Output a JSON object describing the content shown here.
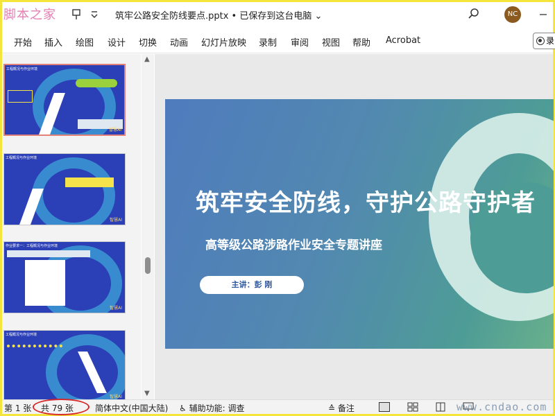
{
  "window": {
    "logo_text": "脚本之家",
    "doc_title": "筑牢公路安全防线要点.pptx • 已保存到这台电脑",
    "avatar_initials": "NC"
  },
  "ribbon": {
    "tabs": [
      "开始",
      "插入",
      "绘图",
      "设计",
      "切换",
      "动画",
      "幻灯片放映",
      "录制",
      "审阅",
      "视图",
      "帮助",
      "Acrobat"
    ],
    "record_label": "录"
  },
  "thumbnails": [
    {
      "label": "智慧AI",
      "heading": "工程概况与作业环境"
    },
    {
      "label": "智慧AI",
      "heading": "工程概况与作业环境"
    },
    {
      "label": "智慧AI",
      "heading": "作业要求一：工程概况与作业环境"
    },
    {
      "label": "智慧AI",
      "heading": "工程概况与作业环境"
    }
  ],
  "slide": {
    "title": "筑牢安全防线，守护公路守护者",
    "subtitle": "高等级公路涉路作业安全专题讲座",
    "presenter": "主讲：彭  刚"
  },
  "status": {
    "slide_index": "第 1 张",
    "slide_total": "共 79 张",
    "language": "简体中文(中国大陆)",
    "accessibility": "辅助功能: 调查",
    "notes": "备注"
  },
  "watermark": "www.cndao.com",
  "colors": {
    "accent_yellow": "#f3e53b",
    "avatar": "#8a5a1f",
    "slide_gradient_start": "#4f7bbd",
    "slide_gradient_end": "#6ab08c",
    "annotation_red": "#d62828"
  }
}
